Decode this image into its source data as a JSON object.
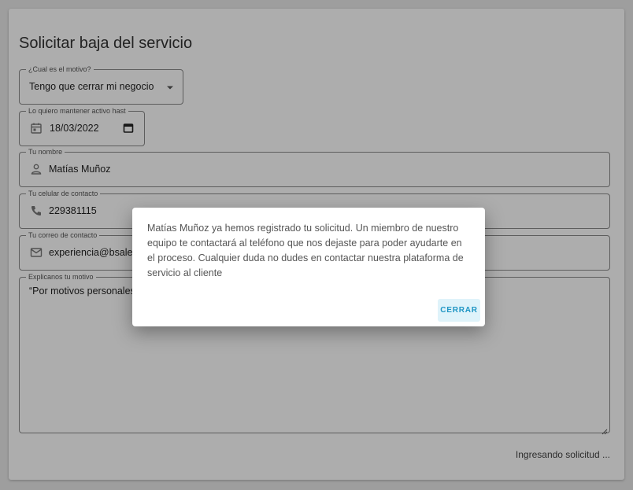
{
  "page": {
    "title": "Solicitar baja del servicio"
  },
  "form": {
    "reason": {
      "label": "¿Cual es el motivo?",
      "value": "Tengo que cerrar mi negocio"
    },
    "active_until": {
      "label": "Lo quiero mantener activo hast",
      "value": "18/03/2022"
    },
    "name": {
      "label": "Tu nombre",
      "value": "Matías Muñoz"
    },
    "phone": {
      "label": "Tu celular de contacto",
      "value": "229381115"
    },
    "email": {
      "label": "Tu correo de contacto",
      "value": "experiencia@bsale."
    },
    "motive": {
      "label": "Explicanos tu motivo",
      "value": "“Por motivos personales"
    }
  },
  "status": {
    "text": "Ingresando solicitud ..."
  },
  "dialog": {
    "message": "Matías Muñoz ya hemos registrado tu solicitud. Un miembro de nuestro equipo te contactará al teléfono que nos dejaste para poder ayudarte en el proceso. Cualquier duda no dudes en contactar nuestra plataforma de servicio al cliente",
    "close_label": "CERRAR"
  },
  "icons": {
    "dropdown": "dropdown-arrow-icon",
    "calendar": "calendar-icon",
    "calendar_picker": "calendar-picker-icon",
    "person": "person-icon",
    "phone": "phone-icon",
    "email": "email-icon"
  },
  "colors": {
    "accent": "#1e95c4",
    "button_bg": "#dff3fa",
    "overlay": "rgba(0,0,0,0.32)"
  }
}
